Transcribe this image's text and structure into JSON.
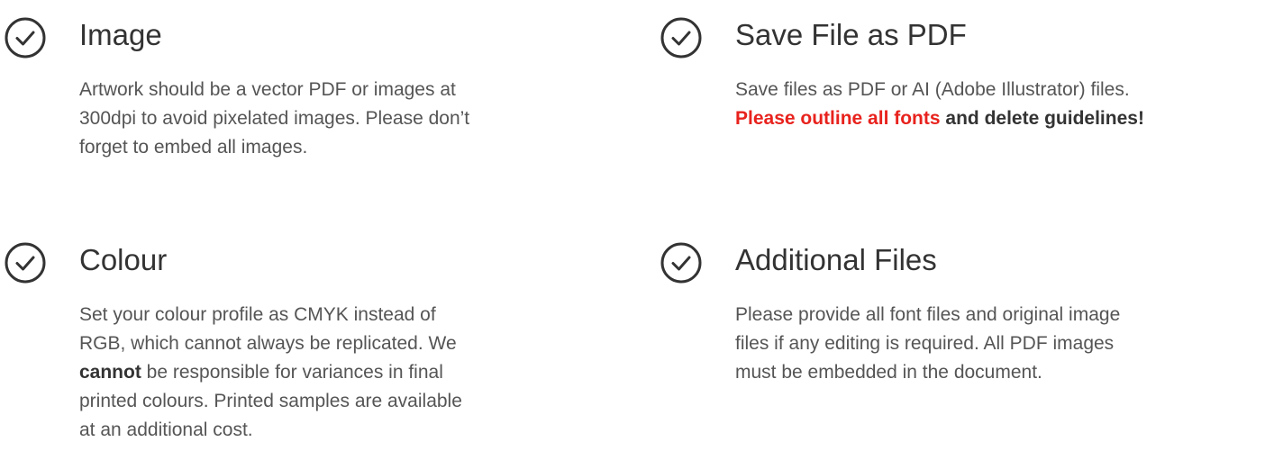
{
  "accent_red": "#e8221d",
  "icon": "check-circle-icon",
  "cards": {
    "image": {
      "title": "Image",
      "lines": [
        "Artwork should be a vector PDF or images at",
        "300dpi to avoid pixelated images. Please don’t",
        "forget to embed all images."
      ]
    },
    "save": {
      "title": "Save File as PDF",
      "line1": "Save files as PDF or AI (Adobe Illustrator) files.",
      "line2_red": "Please outline all fonts",
      "line2_bold": " and delete guidelines!"
    },
    "colour": {
      "title": "Colour",
      "line1": "Set your colour profile as CMYK instead of",
      "line2": "RGB, which cannot always be replicated. We",
      "line3_bold": "cannot",
      "line3_rest": " be responsible for variances in final",
      "line4": "printed colours. Printed samples are available",
      "line5": "at an additional cost."
    },
    "additional": {
      "title": "Additional Files",
      "lines": [
        "Please provide all font files and original image",
        "files if any editing is required. All PDF images",
        "must be embedded in the document."
      ]
    }
  }
}
